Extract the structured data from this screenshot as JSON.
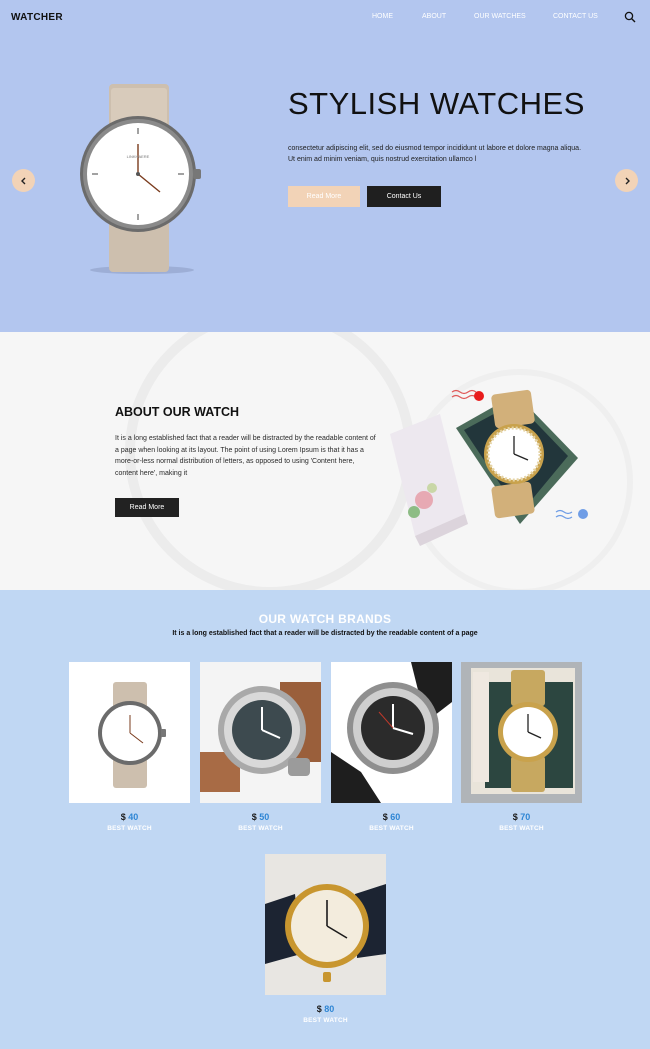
{
  "header": {
    "brand": "WATCHER",
    "nav": [
      "HOME",
      "ABOUT",
      "OUR WATCHES",
      "CONTACT US"
    ],
    "search_icon": "search-icon"
  },
  "hero": {
    "title": "STYLISH WATCHES",
    "text": "consectetur adipiscing elit, sed do eiusmod tempor incididunt ut labore et dolore magna aliqua. Ut enim ad minim veniam, quis nostrud exercitation ullamco l",
    "read_more": "Read More",
    "contact_us": "Contact Us",
    "prev_icon": "chevron-left-icon",
    "next_icon": "chevron-right-icon",
    "watch_brand_text": "LINKHAERE"
  },
  "about": {
    "title": "ABOUT OUR WATCH",
    "text": "It is a long established fact that a reader will be distracted by the readable content of a page when looking at its layout. The point of using Lorem Ipsum is that it has a more-or-less normal distribution of letters, as opposed to using 'Content here, content here', making it",
    "button": "Read More"
  },
  "brands": {
    "title": "OUR WATCH BRANDS",
    "subtitle": "It is a long established fact that a reader will be distracted by the readable content of a page",
    "products": [
      {
        "currency": "$",
        "price": "40",
        "label": "BEST WATCH"
      },
      {
        "currency": "$",
        "price": "50",
        "label": "BEST WATCH"
      },
      {
        "currency": "$",
        "price": "60",
        "label": "BEST WATCH"
      },
      {
        "currency": "$",
        "price": "70",
        "label": "BEST WATCH"
      },
      {
        "currency": "$",
        "price": "80",
        "label": "BEST WATCH"
      }
    ]
  },
  "colors": {
    "hero_bg": "#b3c6ef",
    "brands_bg": "#c0d7f3",
    "accent_peach": "#f2d3b7",
    "dark_button": "#1f1f1f",
    "price_blue": "#2f86d4"
  }
}
